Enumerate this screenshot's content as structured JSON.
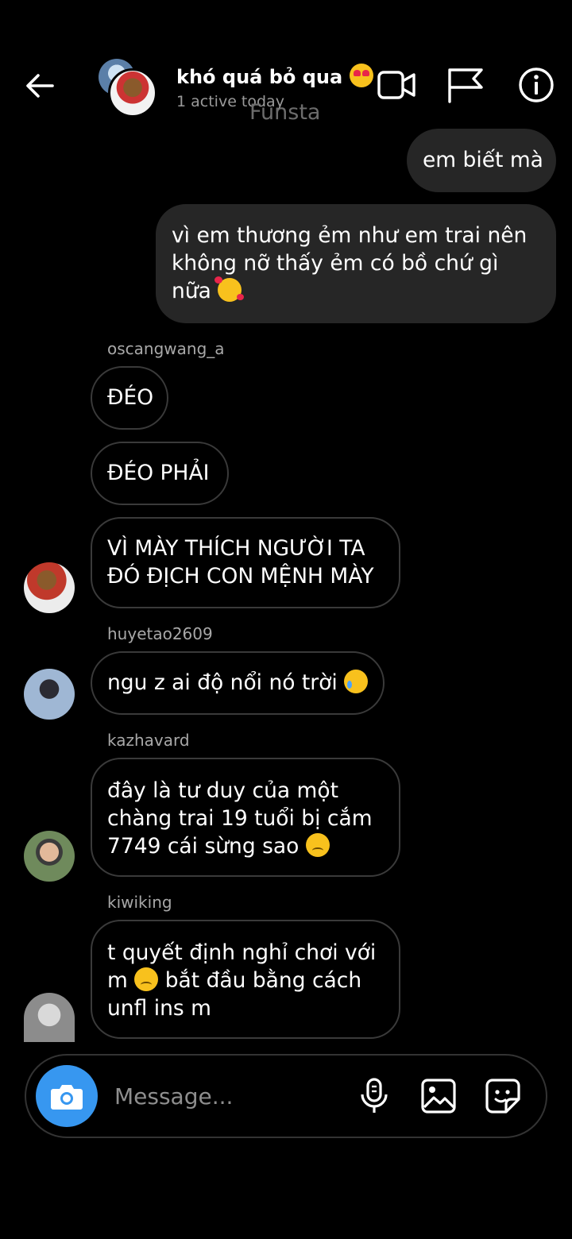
{
  "header": {
    "title": "khó quá bỏ qua",
    "active_status": "1 active today",
    "account_label": "Funsta"
  },
  "messages": {
    "sent_1": "em biết mà",
    "sent_2_l1": "vì em thương ẻm như em trai nên",
    "sent_2_l2": "không nỡ thấy ẻm có bồ chứ gì",
    "sent_2_l3": "nữa",
    "sender_1": "oscangwang_a",
    "recv_1": "ĐÉO",
    "recv_2": "ĐÉO PHẢI",
    "recv_3_l1": "VÌ MÀY THÍCH NGƯỜI TA",
    "recv_3_l2": "ĐÓ ĐỊCH CON MỆNH MÀY",
    "sender_2": "huyetao2609",
    "recv_4": "ngu z ai độ nổi nó trời",
    "sender_3": "kazhavard",
    "recv_5_l1": "đây là tư duy của một",
    "recv_5_l2": "chàng trai 19 tuổi bị cắm",
    "recv_5_l3": "7749 cái sừng sao",
    "sender_4": "kiwiking",
    "recv_6_l1": "t quyết định nghỉ chơi với",
    "recv_6_l2": "m",
    "recv_6_l2b": "bắt đầu bằng cách",
    "recv_6_l3": "unfl ins m"
  },
  "composer": {
    "placeholder": "Message..."
  },
  "icons": {
    "back": "arrow-left-icon",
    "video": "video-camera-icon",
    "flag": "flag-icon",
    "info": "info-icon",
    "camera": "camera-icon",
    "mic": "microphone-icon",
    "gallery": "image-icon",
    "sticker": "sticker-icon"
  },
  "colors": {
    "background": "#000000",
    "sent_bubble": "#262626",
    "camera_button": "#3797f0",
    "secondary_text": "#a8a8a8"
  }
}
